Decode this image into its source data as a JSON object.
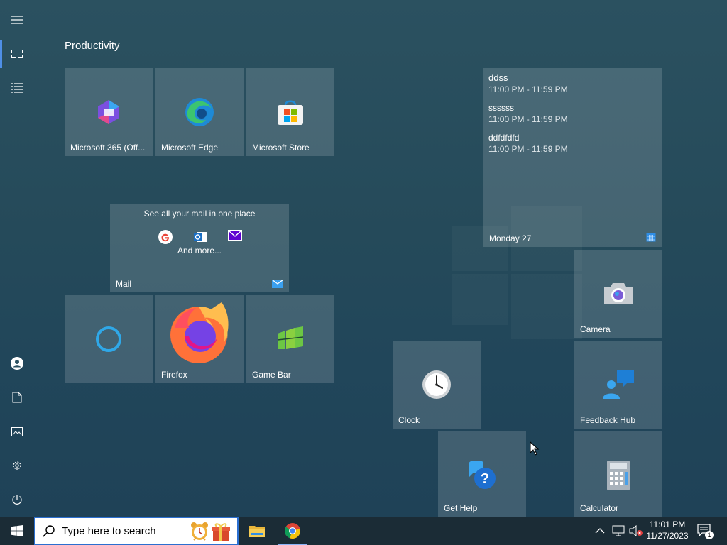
{
  "group": {
    "title": "Productivity"
  },
  "tiles": {
    "m365": "Microsoft 365 (Off...",
    "edge": "Microsoft Edge",
    "store": "Microsoft Store",
    "mail": {
      "label": "Mail",
      "headline": "See all your mail in one place",
      "more": "And more..."
    },
    "cortana": "",
    "firefox": "Firefox",
    "gamebar": "Game Bar",
    "camera": "Camera",
    "clock": "Clock",
    "feedback": "Feedback Hub",
    "gethelp": "Get Help",
    "calculator": "Calculator"
  },
  "calendar": {
    "events": [
      {
        "title": "ddss",
        "time": "11:00 PM - 11:59 PM"
      },
      {
        "title": "ssssss",
        "time": "11:00 PM - 11:59 PM"
      },
      {
        "title": "ddfdfdfd",
        "time": "11:00 PM - 11:59 PM"
      }
    ],
    "day": "Monday 27"
  },
  "taskbar": {
    "search_placeholder": "Type here to search",
    "time": "11:01 PM",
    "date": "11/27/2023",
    "notification_count": "1"
  },
  "colors": {
    "accent": "#4f8fe6",
    "taskbar": "#1b2c36"
  }
}
